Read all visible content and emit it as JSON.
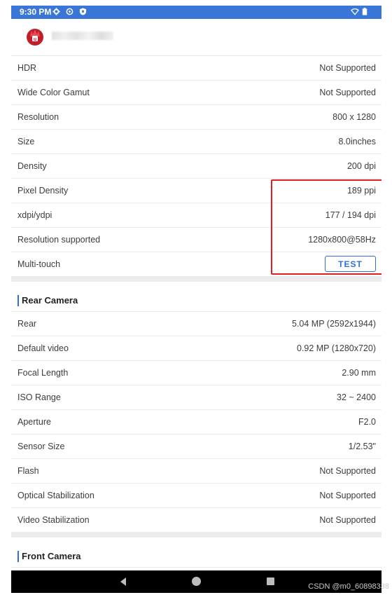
{
  "status_bar": {
    "time": "9:30 PM"
  },
  "display_rows": [
    {
      "label": "HDR",
      "value": "Not Supported"
    },
    {
      "label": "Wide Color Gamut",
      "value": "Not Supported"
    },
    {
      "label": "Resolution",
      "value": "800 x 1280"
    },
    {
      "label": "Size",
      "value": "8.0inches"
    },
    {
      "label": "Density",
      "value": "200 dpi"
    },
    {
      "label": "Pixel Density",
      "value": "189 ppi"
    },
    {
      "label": "xdpi/ydpi",
      "value": "177 / 194 dpi"
    },
    {
      "label": "Resolution supported",
      "value": "1280x800@58Hz"
    },
    {
      "label": "Multi-touch",
      "button": "TEST"
    }
  ],
  "rear_camera": {
    "title": "Rear Camera",
    "rows": [
      {
        "label": "Rear",
        "value": "5.04 MP (2592x1944)"
      },
      {
        "label": "Default video",
        "value": "0.92 MP (1280x720)"
      },
      {
        "label": "Focal Length",
        "value": "2.90 mm"
      },
      {
        "label": "ISO Range",
        "value": "32 ~ 2400"
      },
      {
        "label": "Aperture",
        "value": "F2.0"
      },
      {
        "label": "Sensor Size",
        "value": "1/2.53\""
      },
      {
        "label": "Flash",
        "value": "Not Supported"
      },
      {
        "label": "Optical Stabilization",
        "value": "Not Supported"
      },
      {
        "label": "Video Stabilization",
        "value": "Not Supported"
      }
    ]
  },
  "front_camera": {
    "title": "Front Camera"
  },
  "watermark": "CSDN @m0_60898338",
  "colors": {
    "status_bar": "#3a76d8",
    "accent": "#2f6fd6",
    "highlight": "#e02020",
    "nav_bar": "#000000"
  }
}
